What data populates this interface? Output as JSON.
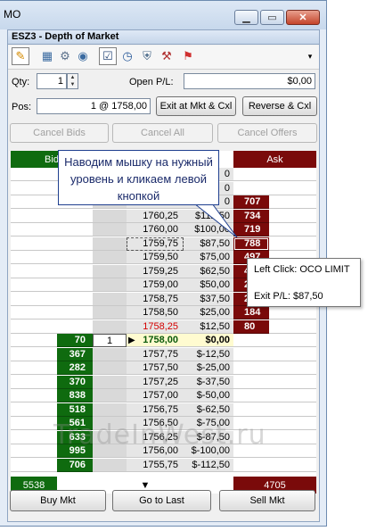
{
  "window": {
    "title": "MO",
    "panel_title": "ESZ3 - Depth of Market"
  },
  "toolbar": {
    "icons": [
      "brush-icon",
      "calculator-icon",
      "gear-icon",
      "eye-icon",
      "checklist-icon",
      "clock-icon",
      "shield-icon",
      "tools-icon",
      "flag-icon"
    ],
    "overflow": "▾"
  },
  "form": {
    "qty_label": "Qty:",
    "qty_value": "1",
    "open_pl_label": "Open P/L:",
    "open_pl_value": "$0,00",
    "pos_label": "Pos:",
    "pos_value": "1 @ 1758,00"
  },
  "buttons": {
    "exit_mkt": "Exit at Mkt & Cxl",
    "reverse": "Reverse & Cxl",
    "cancel_bids": "Cancel Bids",
    "cancel_all": "Cancel All",
    "cancel_offers": "Cancel Offers",
    "buy_mkt": "Buy Mkt",
    "go_to_last": "Go to Last",
    "sell_mkt": "Sell Mkt"
  },
  "dom": {
    "bid_header": "Bid",
    "ask_header": "Ask",
    "bid_total": "5538",
    "ask_total": "4705",
    "scroll_arrow": "▼",
    "rows": [
      {
        "bid": "",
        "ord": "",
        "price": "",
        "pl": "0",
        "ask": ""
      },
      {
        "bid": "",
        "ord": "",
        "price": "",
        "pl": "0",
        "ask": ""
      },
      {
        "bid": "",
        "ord": "",
        "price": "",
        "pl": "0",
        "ask": "707"
      },
      {
        "bid": "",
        "ord": "",
        "price": "1760,25",
        "pl": "$112,50",
        "ask": "734"
      },
      {
        "bid": "",
        "ord": "",
        "price": "1760,00",
        "pl": "$100,00",
        "ask": "719"
      },
      {
        "bid": "",
        "ord": "",
        "price": "1759,75",
        "pl": "$87,50",
        "ask": "788"
      },
      {
        "bid": "",
        "ord": "",
        "price": "1759,50",
        "pl": "$75,00",
        "ask": "497"
      },
      {
        "bid": "",
        "ord": "",
        "price": "1759,25",
        "pl": "$62,50",
        "ask": "4"
      },
      {
        "bid": "",
        "ord": "",
        "price": "1759,00",
        "pl": "$50,00",
        "ask": "2"
      },
      {
        "bid": "",
        "ord": "",
        "price": "1758,75",
        "pl": "$37,50",
        "ask": "2"
      },
      {
        "bid": "",
        "ord": "",
        "price": "1758,50",
        "pl": "$25,00",
        "ask": "184"
      },
      {
        "bid": "",
        "ord": "",
        "price": "1758,25",
        "pl": "$12,50",
        "ask": "80"
      },
      {
        "bid": "70",
        "ord": "1",
        "price": "1758,00",
        "pl": "$0,00",
        "ask": ""
      },
      {
        "bid": "367",
        "ord": "",
        "price": "1757,75",
        "pl": "$-12,50",
        "ask": ""
      },
      {
        "bid": "282",
        "ord": "",
        "price": "1757,50",
        "pl": "$-25,00",
        "ask": ""
      },
      {
        "bid": "370",
        "ord": "",
        "price": "1757,25",
        "pl": "$-37,50",
        "ask": ""
      },
      {
        "bid": "838",
        "ord": "",
        "price": "1757,00",
        "pl": "$-50,00",
        "ask": ""
      },
      {
        "bid": "518",
        "ord": "",
        "price": "1756,75",
        "pl": "$-62,50",
        "ask": ""
      },
      {
        "bid": "561",
        "ord": "",
        "price": "1756,50",
        "pl": "$-75,00",
        "ask": ""
      },
      {
        "bid": "633",
        "ord": "",
        "price": "1756,25",
        "pl": "$-87,50",
        "ask": ""
      },
      {
        "bid": "995",
        "ord": "",
        "price": "1756,00",
        "pl": "$-100,00",
        "ask": ""
      },
      {
        "bid": "706",
        "ord": "",
        "price": "1755,75",
        "pl": "$-112,50",
        "ask": ""
      }
    ]
  },
  "callout": {
    "text": "Наводим мышку на нужный уровень и кликаем левой кнопкой"
  },
  "tooltip": {
    "line1": "Left Click: OCO LIMIT",
    "line2": "Exit P/L: $87,50"
  },
  "watermark": "TradeInWest.ru",
  "colors": {
    "bid": "#0f6b0f",
    "ask": "#7a0a0a",
    "last_price_row": "#fffbd0",
    "red_price": "#d40000"
  }
}
